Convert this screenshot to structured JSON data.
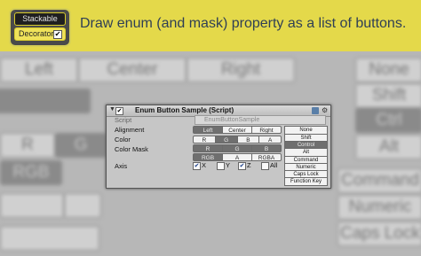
{
  "background": {
    "row1": [
      "Left",
      "Center",
      "Right",
      "None"
    ],
    "row1_side": "Shift",
    "row2_side": "Ctrl",
    "row3": [
      "R",
      "G"
    ],
    "row3_side": "Alt",
    "row5": [
      "RGB"
    ],
    "row5_side": "Command",
    "row6_side": "Numeric",
    "row7_side": "Caps Lock"
  },
  "banner": {
    "text": "Draw enum (and mask) property as a list of buttons.",
    "badge_stackable": "Stackable",
    "badge_decorator": "Decorator",
    "decorator_checked": "✔"
  },
  "inspector": {
    "title": "Enum Button Sample (Script)",
    "enabled_check": "✔",
    "script_label": "Script",
    "script_value": "EnumButtonSample",
    "fields": {
      "alignment": {
        "label": "Alignment",
        "options": [
          "Left",
          "Center",
          "Right"
        ],
        "selected": "Left"
      },
      "color": {
        "label": "Color",
        "options": [
          "R",
          "G",
          "B",
          "A"
        ],
        "selected": "G"
      },
      "color_mask": {
        "label": "Color Mask",
        "row1": [
          "R",
          "G",
          "B"
        ],
        "row2": [
          "RGB",
          "A",
          "RGBA"
        ]
      },
      "axis": {
        "label": "Axis",
        "options": [
          "X",
          "Y",
          "Z",
          "All"
        ],
        "checked": [
          "X",
          "Z"
        ]
      }
    },
    "modifiers": [
      "None",
      "Shift",
      "Control",
      "Alt",
      "Command",
      "Numeric",
      "Caps Lock",
      "Function Key"
    ],
    "modifier_selected": "Control"
  }
}
